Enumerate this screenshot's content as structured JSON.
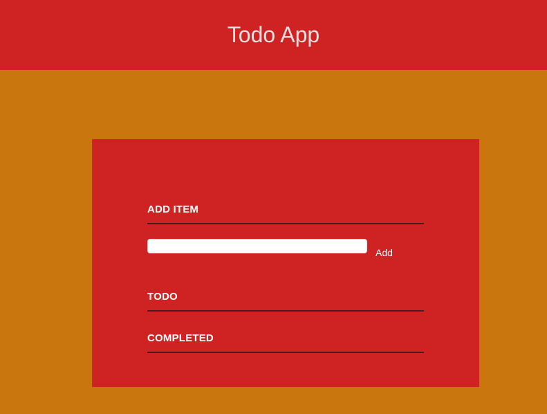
{
  "header": {
    "title": "Todo App"
  },
  "add_section": {
    "heading": "ADD ITEM",
    "input_value": "",
    "input_placeholder": "",
    "button_label": "Add"
  },
  "todo_section": {
    "heading": "TODO",
    "items": []
  },
  "completed_section": {
    "heading": "COMPLETED",
    "items": []
  },
  "colors": {
    "header_bg": "#cf2323",
    "page_bg": "#c9760e",
    "card_bg": "#cf2323",
    "rule": "#4a1c1c",
    "title_text": "#f2dede"
  }
}
